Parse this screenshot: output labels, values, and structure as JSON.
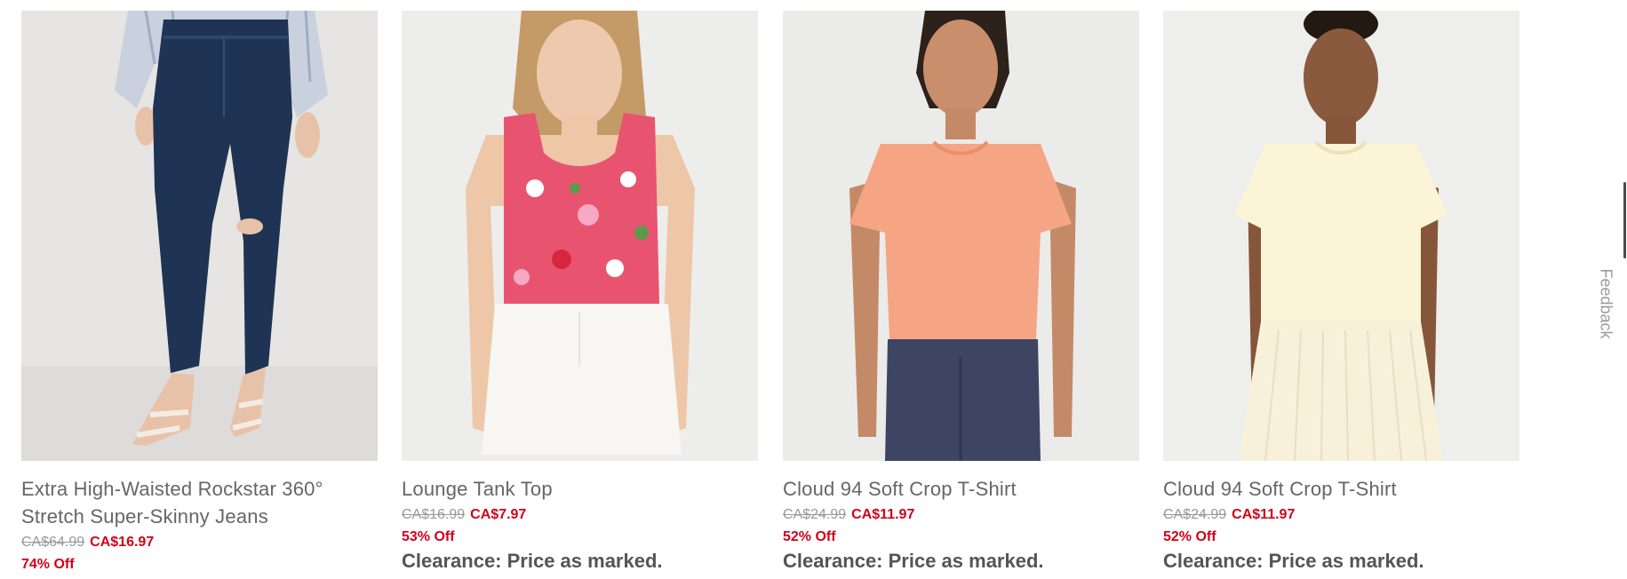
{
  "products": [
    {
      "name_line1": "Extra High-Waisted Rockstar 360°",
      "name_line2": "Stretch Super-Skinny Jeans",
      "was_price": "CA$64.99",
      "sale_price": "CA$16.97",
      "discount": "74% Off",
      "clearance": "",
      "image": "jeans-photo"
    },
    {
      "name_line1": "Lounge Tank Top",
      "name_line2": "",
      "was_price": "CA$16.99",
      "sale_price": "CA$7.97",
      "discount": "53% Off",
      "clearance": "Clearance: Price as marked.",
      "image": "floral-tank-photo"
    },
    {
      "name_line1": "Cloud 94 Soft Crop T-Shirt",
      "name_line2": "",
      "was_price": "CA$24.99",
      "sale_price": "CA$11.97",
      "discount": "52% Off",
      "clearance": "Clearance: Price as marked.",
      "image": "peach-tshirt-photo"
    },
    {
      "name_line1": "Cloud 94 Soft Crop T-Shirt",
      "name_line2": "",
      "was_price": "CA$24.99",
      "sale_price": "CA$11.97",
      "discount": "52% Off",
      "clearance": "Clearance: Price as marked.",
      "image": "cream-tshirt-photo"
    }
  ],
  "feedback_label": "Feedback",
  "colors": {
    "sale": "#d0021b",
    "was": "#999999",
    "name": "#666666"
  }
}
